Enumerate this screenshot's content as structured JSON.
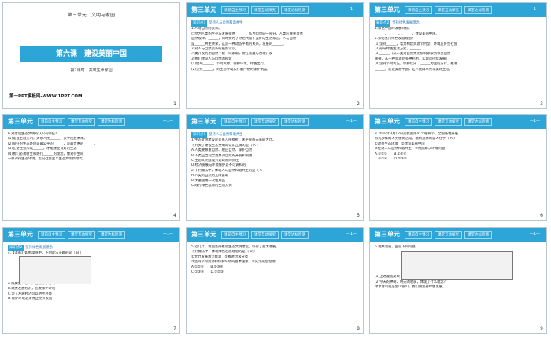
{
  "title_slide": {
    "unit": "第三单元　文明与家园",
    "lesson": "第六课　建设美丽中国",
    "sub": "第2课时　共筑生命家园",
    "footer": "第一PPT模板网-WWW.1PPT.COM",
    "num": "1"
  },
  "common": {
    "unit": "第三单元",
    "tabs": [
      "课前自主预习",
      "课堂互动探究",
      "课堂达标检测"
    ],
    "pg": "—1—"
  },
  "slides": [
    {
      "num": "2",
      "tag": "知识点1",
      "head": "坚持人与自然和谐共生",
      "lines": [
        "1.人与自然的关系。",
        "自然为人类的生存与发展提供______，作为自然的一部分，人类应尊重自然",
        "自然规律，______，同时要为子孙后代留下美好的生活家园，人与自然",
        "是______共生共荣，这是一种动态平衡的关系，发展的______。",
        "2.对人与自然关系的最新认识。",
        "人类开发利用自然不能一味索取，要在适度与合理开发",
        "3.我们建设人与自然的和谐",
        "(1)倡导______，节约资源，保护环境，绿色出行。",
        "(2)坚持______，对生态环境实行最严格的保护制度。"
      ]
    },
    {
      "num": "3",
      "tag": "知识点2",
      "head": "坚持绿色发展理念",
      "lines": [
        "4.绿色中国的发展目标。",
        "______、______、______，建设美丽中国。",
        "5.如何坚持绿色发展理念？",
        "(1)坚持______，着力构建资源节约型、环境友好型社会",
        "(2)形成绿色生活方式，______。",
        "(3)______（从人类对自然界无限制索取到尊重自然",
        "规律，从一种资源到多种利用，实现可持续发展）",
        "(4)坚持节约优先，保护优先、______为主的方针，推进",
        "______，建设美丽中国，让人民群众共享美好生活。"
      ]
    },
    {
      "num": "4",
      "tag": "",
      "head": "",
      "lines": [
        "6.对建设生态文明的认识有哪些？",
        "(1)建设生态文明，关系人民______，关乎民族未来。",
        "(2)良好的生态环境是最公平的______，是最普惠的______。",
        "(3)在全社会形成______，才能建立良好的生态",
        "(4)我们必须树立和践行______的理念，像对待生命",
        "一样对待生态环境，走向社会主义生态文明新时代。"
      ]
    },
    {
      "num": "5",
      "tag": "知识点1",
      "head": "坚持人与自然和谐共生",
      "lines": [
        "1.生态文明建设是关系人民福祉、关乎民族未来的大计。",
        "下列关于建设生态文明的认识正确的是（ A ）",
        "A.人类要尊重自然、顺应自然、保护自然",
        "B.人类应当完全放弃对自然的开发和利用",
        "C.生态文明建设只是政府的责任",
        "D.经济发展与环境保护是不可调和的",
        "2.下列做法中，体现人与自然和谐共生的是（ C ）",
        "A.人类对自然的无限索取",
        "B.大量使用一次性用品",
        "C.践行绿色低碳的生活方式"
      ]
    },
    {
      "num": "6",
      "tag": "",
      "head": "",
      "lines": [
        "3.2019年3月12日是我国第41个植树节，全国各地开展",
        "形式多样的义务植树活动。植树造林的意义在于（ A ）",
        "①改善生态环境　②建设美丽中国",
        "③促进人与自然和谐共生　④彻底解决环境问题",
        "A.①②③　　B.①②④",
        "C.①③④　　D.②③④"
      ]
    },
    {
      "num": "7",
      "tag": "知识点2",
      "head": "坚持绿色发展理念",
      "lines": [
        "4.【漫画】如图漫画中，下列说法正确的是（ B ）",
        "",
        "",
        "",
        "",
        "",
        "A.既要金山银山，也要绿水青山",
        "B.既要发展经济，也要保护环境",
        "C.为了发展经济可以牺牲环境",
        "D.保护环境必须停止经济发展"
      ]
    },
    {
      "num": "8",
      "tag": "",
      "head": "",
      "lines": [
        "5.近几年，我国坚持推进生态文明建设，取得了重大进展。",
        "下列做法中，体现绿色发展理念的是（ D ）",
        "①大力发展清洁能源　②推进垃圾分类",
        "③坚持节约资源和保护环境的基本国策　④先污染后治理",
        "A.①②④　　B.②③④",
        "C.①③④　　D.①②③"
      ]
    },
    {
      "num": "9",
      "tag": "",
      "head": "",
      "lines": [
        "6.观察漫画，回答下列问题。",
        "",
        "",
        "",
        "",
        "",
        "(1)上述漫画反映了什么问题？",
        "(2)今天的种树、明天的收获，体现了什么理念？",
        "绿水青山就是金山银山，我们要坚持绿色发展。"
      ]
    }
  ]
}
